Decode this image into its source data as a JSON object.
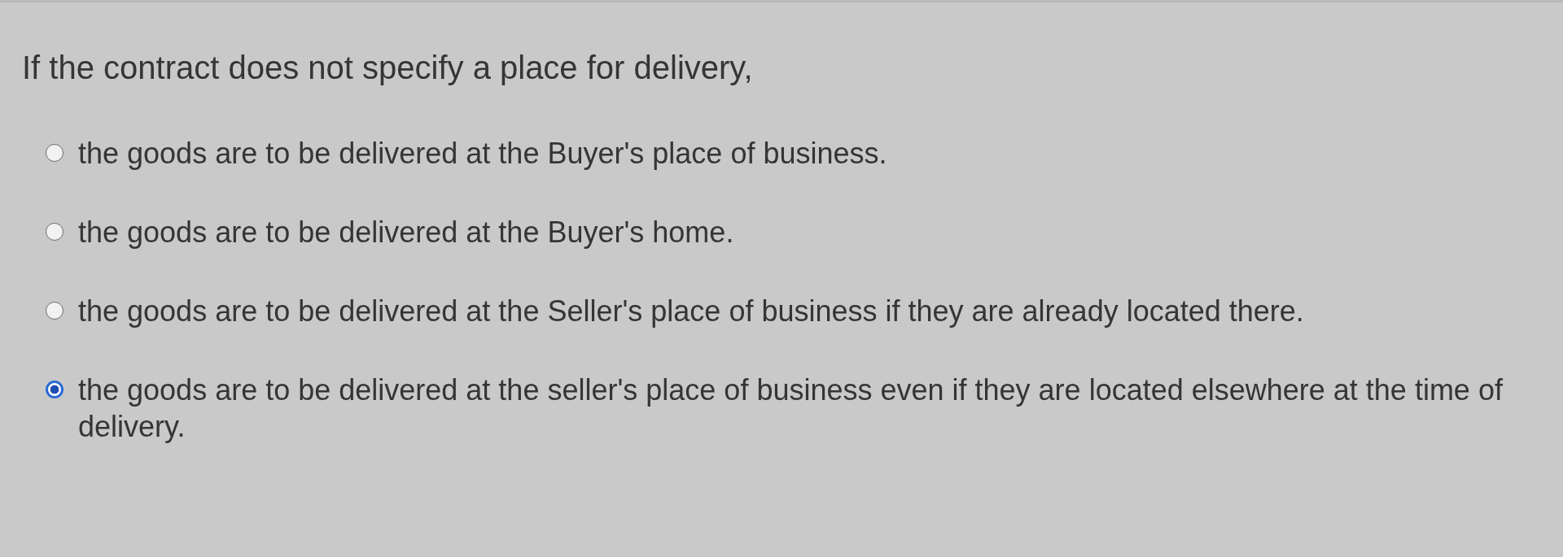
{
  "question": "If the contract does not specify a place for delivery,",
  "options": [
    {
      "label": "the goods are to be delivered at the Buyer's place of business.",
      "selected": false
    },
    {
      "label": "the goods are to be delivered at the Buyer's home.",
      "selected": false
    },
    {
      "label": "the goods are to be delivered at the Seller's place of business if they are already located there.",
      "selected": false
    },
    {
      "label": "the goods are to be delivered at the seller's place of business even if they are located elsewhere at the time of delivery.",
      "selected": true
    }
  ]
}
